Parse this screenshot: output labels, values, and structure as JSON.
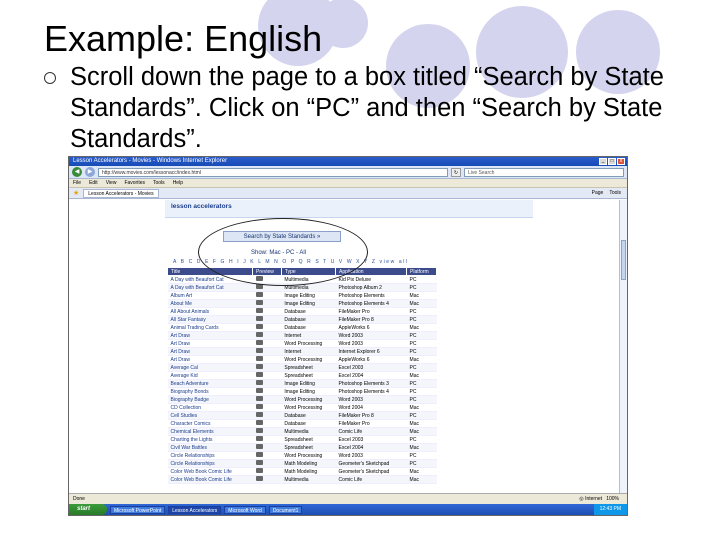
{
  "slide": {
    "title": "Example: English",
    "bullet": "Scroll down the page to a box titled “Search by State Standards”.  Click on “PC” and then “Search by State Standards”."
  },
  "colors": {
    "decor_circle": "#d4d4ee",
    "site_header_bar": "#3c4b8c",
    "xp_titlebar": "#2a5ccc"
  },
  "browser": {
    "window_title": "Lesson Accelerators - Movies - Windows Internet Explorer",
    "address": "http://www.movies.com/lessonacc/index.html",
    "search_placeholder": "Live Search",
    "menu": [
      "File",
      "Edit",
      "View",
      "Favorites",
      "Tools",
      "Help"
    ],
    "tab_label": "Lesson Accelerators - Movies",
    "toolbar": [
      "Page",
      "Tools"
    ],
    "status_left": "Done",
    "status_zone": "Internet",
    "zoom": "100%"
  },
  "site": {
    "header": "lesson accelerators",
    "search_button": "Search by State Standards »",
    "show_row": "Show:  Mac  -  PC  -  All",
    "alphabet": "A B C D E F G H I J K L M N O P Q R S T U V W X Y Z  view all",
    "table": {
      "headers": [
        "Title",
        "Preview",
        "Type",
        "Application",
        "Platform"
      ],
      "rows": [
        [
          "A Day with Beaufort Cat",
          "Multimedia",
          "Kid Pix Deluxe",
          "PC"
        ],
        [
          "A Day with Beaufort Cat",
          "Multimedia",
          "Photoshop Album 2",
          "PC"
        ],
        [
          "Album Art",
          "Image Editing",
          "Photoshop Elements",
          "Mac"
        ],
        [
          "About Me",
          "Image Editing",
          "Photoshop Elements 4",
          "Mac"
        ],
        [
          "All About Animals",
          "Database",
          "FileMaker Pro",
          "PC"
        ],
        [
          "All Star Fantasy",
          "Database",
          "FileMaker Pro 8",
          "PC"
        ],
        [
          "Animal Trading Cards",
          "Database",
          "AppleWorks 6",
          "Mac"
        ],
        [
          "Art Draw",
          "Internet",
          "Word 2003",
          "PC"
        ],
        [
          "Art Draw",
          "Word Processing",
          "Word 2003",
          "PC"
        ],
        [
          "Art Draw",
          "Internet",
          "Internet Explorer 6",
          "PC"
        ],
        [
          "Art Draw",
          "Word Processing",
          "AppleWorks 6",
          "Mac"
        ],
        [
          "Average Cal",
          "Spreadsheet",
          "Excel 2003",
          "PC"
        ],
        [
          "Average Kid",
          "Spreadsheet",
          "Excel 2004",
          "Mac"
        ],
        [
          "Beach Adventure",
          "Image Editing",
          "Photoshop Elements 3",
          "PC"
        ],
        [
          "Biography Bonds",
          "Image Editing",
          "Photoshop Elements 4",
          "PC"
        ],
        [
          "Biography Badge",
          "Word Processing",
          "Word 2003",
          "PC"
        ],
        [
          "CD Collection",
          "Word Processing",
          "Word 2004",
          "Mac"
        ],
        [
          "Cell Studies",
          "Database",
          "FileMaker Pro 8",
          "PC"
        ],
        [
          "Character Comics",
          "Database",
          "FileMaker Pro",
          "Mac"
        ],
        [
          "Chemical Elements",
          "Multimedia",
          "Comic Life",
          "Mac"
        ],
        [
          "Charting the Lights",
          "Spreadsheet",
          "Excel 2003",
          "PC"
        ],
        [
          "Civil War Battles",
          "Spreadsheet",
          "Excel 2004",
          "Mac"
        ],
        [
          "Circle Relationships",
          "Word Processing",
          "Word 2003",
          "PC"
        ],
        [
          "Circle Relationships",
          "Math Modeling",
          "Geometer's Sketchpad",
          "PC"
        ],
        [
          "Color Web Book Comic Life",
          "Math Modeling",
          "Geometer's Sketchpad",
          "Mac"
        ],
        [
          "Color Web Book Comic Life",
          "Multimedia",
          "Comic Life",
          "Mac"
        ]
      ]
    }
  },
  "taskbar": {
    "start": "start",
    "tasks": [
      "Microsoft PowerPoint",
      "Lesson Accelerators",
      "Microsoft Word",
      "Document1"
    ],
    "clock": "12:43 PM"
  }
}
